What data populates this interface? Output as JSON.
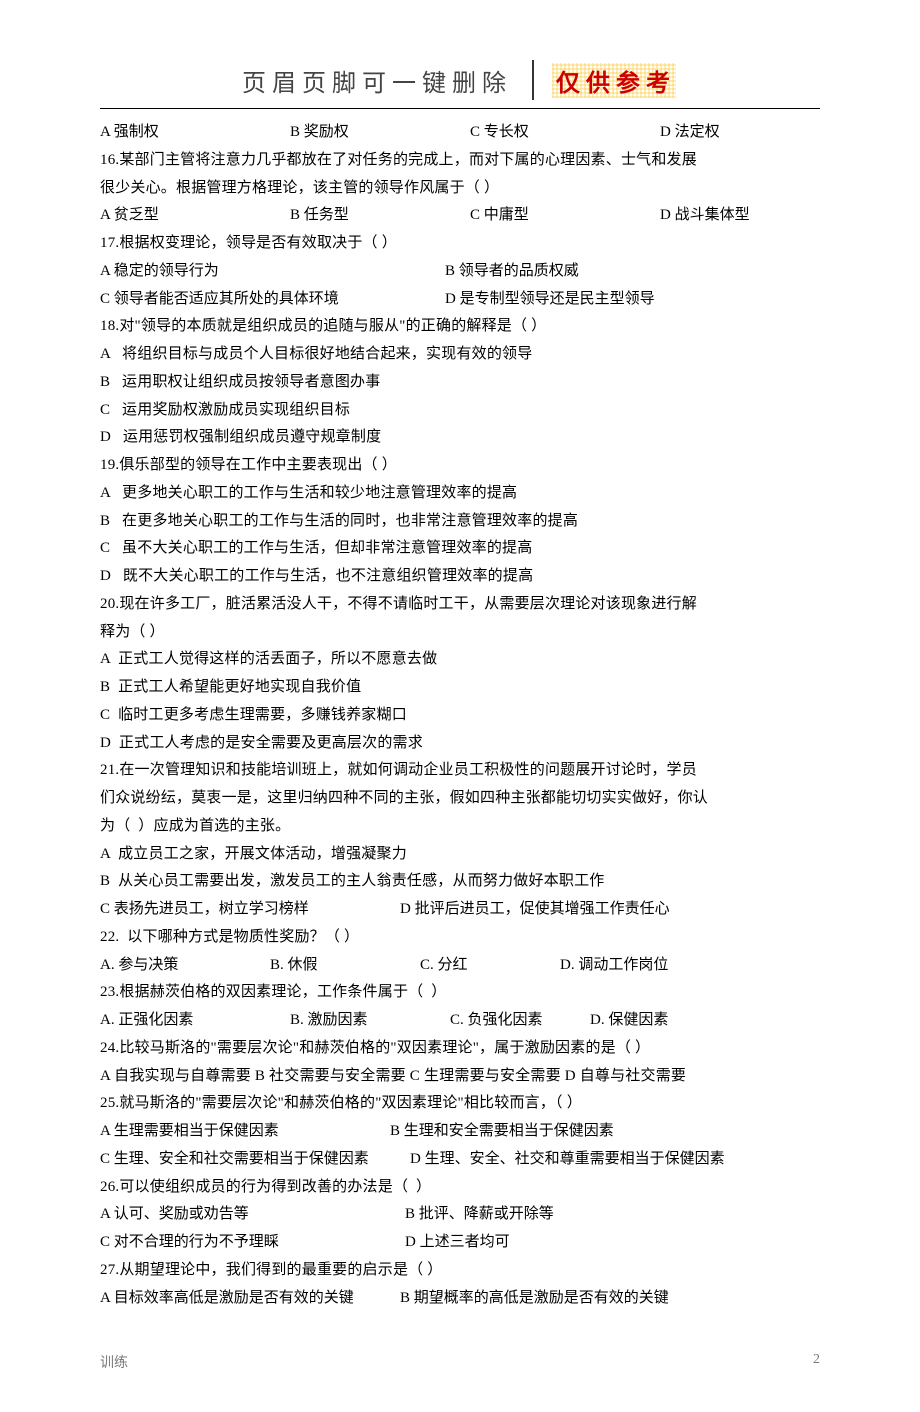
{
  "header": {
    "left": "页眉页脚可一键删除",
    "right": "仅供参考"
  },
  "q15": {
    "a": "A  强制权",
    "b": "B  奖励权",
    "c": "C  专长权",
    "d": "D  法定权"
  },
  "q16": {
    "stem1": "16.某部门主管将注意力几乎都放在了对任务的完成上，而对下属的心理因素、士气和发展",
    "stem2": "很少关心。根据管理方格理论，该主管的领导作风属于（ ）",
    "a": "A  贫乏型",
    "b": "B  任务型",
    "c": "C 中庸型",
    "d": "D  战斗集体型"
  },
  "q17": {
    "stem": "17.根据权变理论，领导是否有效取决于（ ）",
    "a": "A  稳定的领导行为",
    "b": "B 领导者的品质权威",
    "c": "C  领导者能否适应其所处的具体环境",
    "d": "D 是专制型领导还是民主型领导"
  },
  "q18": {
    "stem": "18.对\"领导的本质就是组织成员的追随与服从\"的正确的解释是（ ）",
    "a": "A   将组织目标与成员个人目标很好地结合起来，实现有效的领导",
    "b": "B   运用职权让组织成员按领导者意图办事",
    "c": "C   运用奖励权激励成员实现组织目标",
    "d": "D   运用惩罚权强制组织成员遵守规章制度"
  },
  "q19": {
    "stem": "19.俱乐部型的领导在工作中主要表现出（ ）",
    "a": "A   更多地关心职工的工作与生活和较少地注意管理效率的提高",
    "b": "B   在更多地关心职工的工作与生活的同时，也非常注意管理效率的提高",
    "c": "C   虽不大关心职工的工作与生活，但却非常注意管理效率的提高",
    "d": "D   既不大关心职工的工作与生活，也不注意组织管理效率的提高"
  },
  "q20": {
    "stem1": "20.现在许多工厂，脏活累活没人干，不得不请临时工干，从需要层次理论对该现象进行解",
    "stem2": "释为（ ）",
    "a": "A  正式工人觉得这样的活丢面子，所以不愿意去做",
    "b": "B  正式工人希望能更好地实现自我价值",
    "c": "C  临时工更多考虑生理需要，多赚钱养家糊口",
    "d": "D  正式工人考虑的是安全需要及更高层次的需求"
  },
  "q21": {
    "stem1": "21.在一次管理知识和技能培训班上，就如何调动企业员工积极性的问题展开讨论时，学员",
    "stem2": "们众说纷纭，莫衷一是，这里归纳四种不同的主张，假如四种主张都能切切实实做好，你认",
    "stem3": "为（  ）应成为首选的主张。",
    "a": "A  成立员工之家，开展文体活动，增强凝聚力",
    "b": "B  从关心员工需要出发，激发员工的主人翁责任感，从而努力做好本职工作",
    "c": "C  表扬先进员工，树立学习榜样",
    "d": "D   批评后进员工，促使其增强工作责任心"
  },
  "q22": {
    "stem": "22.  以下哪种方式是物质性奖励？（ ）",
    "a": "A. 参与决策",
    "b": "B. 休假",
    "c": "C. 分红",
    "d": "D. 调动工作岗位"
  },
  "q23": {
    "stem": "23.根据赫茨伯格的双因素理论，工作条件属于（  ）",
    "a": "A. 正强化因素",
    "b": "B. 激励因素",
    "c": "C. 负强化因素",
    "d": "D. 保健因素"
  },
  "q24": {
    "stem": "24.比较马斯洛的\"需要层次论\"和赫茨伯格的\"双因素理论\"，属于激励因素的是（ ）",
    "opts": "A 自我实现与自尊需要 B 社交需要与安全需要 C 生理需要与安全需要 D 自尊与社交需要"
  },
  "q25": {
    "stem": "25.就马斯洛的\"需要层次论\"和赫茨伯格的\"双因素理论\"相比较而言，（ ）",
    "a": "A 生理需要相当于保健因素",
    "b": "B 生理和安全需要相当于保健因素",
    "c": "C 生理、安全和社交需要相当于保健因素",
    "d": "D 生理、安全、社交和尊重需要相当于保健因素"
  },
  "q26": {
    "stem": "26.可以使组织成员的行为得到改善的办法是（  ）",
    "a": "A  认可、奖励或劝告等",
    "b": "B 批评、降薪或开除等",
    "c": "C  对不合理的行为不予理睬",
    "d": "D 上述三者均可"
  },
  "q27": {
    "stem": "27.从期望理论中，我们得到的最重要的启示是（ ）",
    "a": "A 目标效率高低是激励是否有效的关键",
    "b": "B 期望概率的高低是激励是否有效的关键"
  },
  "footer": {
    "left": "训练",
    "right": "2"
  }
}
